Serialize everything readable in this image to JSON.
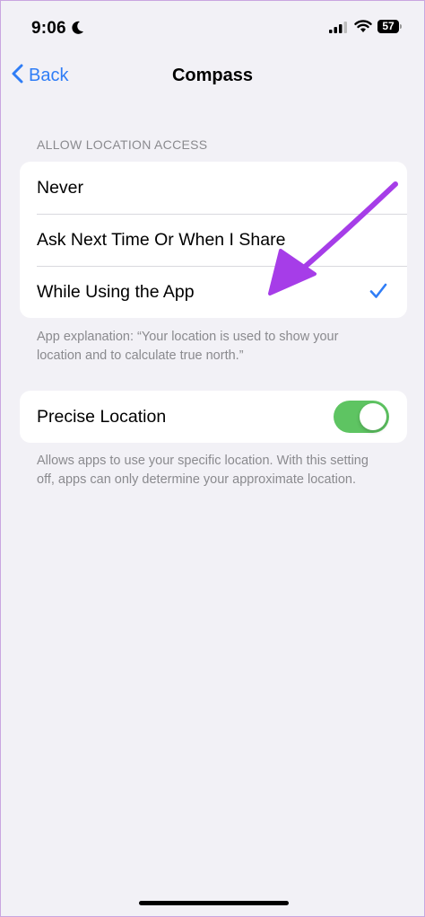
{
  "status_bar": {
    "time": "9:06",
    "battery": "57"
  },
  "nav": {
    "back_label": "Back",
    "title": "Compass"
  },
  "location_access": {
    "header": "ALLOW LOCATION ACCESS",
    "options": [
      {
        "label": "Never",
        "selected": false
      },
      {
        "label": "Ask Next Time Or When I Share",
        "selected": false
      },
      {
        "label": "While Using the App",
        "selected": true
      }
    ],
    "explanation": "App explanation: “Your location is used to show your location and to calculate true north.”"
  },
  "precise_location": {
    "label": "Precise Location",
    "enabled": true,
    "description": "Allows apps to use your specific location. With this setting off, apps can only determine your approximate location."
  },
  "colors": {
    "accent": "#2f7df6",
    "toggle_on": "#5ec462",
    "annotation_arrow": "#a63de8",
    "background": "#f2f1f6"
  },
  "icons": [
    "moon-icon",
    "cellular-signal-icon",
    "wifi-icon",
    "battery-icon",
    "chevron-left-icon",
    "checkmark-icon"
  ]
}
